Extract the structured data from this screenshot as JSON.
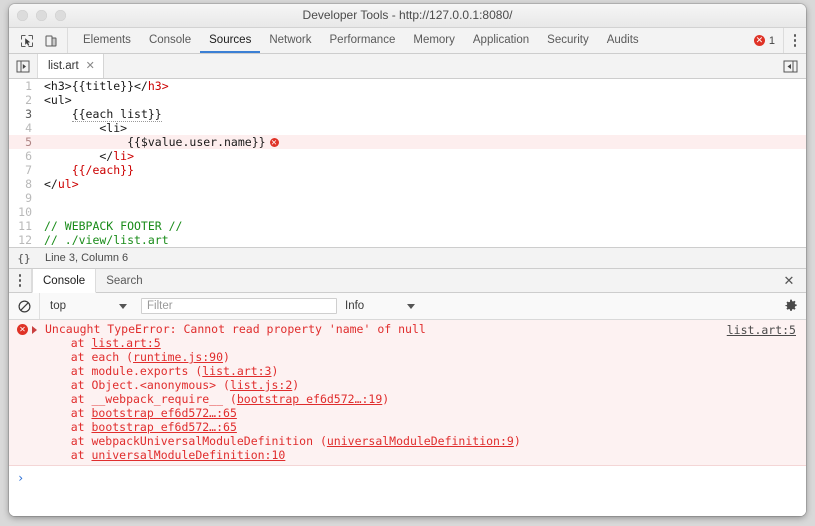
{
  "window": {
    "title": "Developer Tools - http://127.0.0.1:8080/",
    "traffic_lights": [
      "close",
      "minimize",
      "maximize"
    ]
  },
  "toolbar": {
    "inspect_icon": "inspect-element-icon",
    "device_icon": "device-toolbar-icon",
    "panels": [
      {
        "label": "Elements",
        "active": false
      },
      {
        "label": "Console",
        "active": false
      },
      {
        "label": "Sources",
        "active": true
      },
      {
        "label": "Network",
        "active": false
      },
      {
        "label": "Performance",
        "active": false
      },
      {
        "label": "Memory",
        "active": false
      },
      {
        "label": "Application",
        "active": false
      },
      {
        "label": "Security",
        "active": false
      },
      {
        "label": "Audits",
        "active": false
      }
    ],
    "error_count": "1",
    "error_dot_glyph": "✕",
    "accent_color": "#3b7fd4",
    "error_color": "#df3226",
    "menu_icon": "more-vertical-icon"
  },
  "sources": {
    "navigator_toggle_icon": "show-navigator-icon",
    "file_tab": {
      "label": "list.art",
      "close_glyph": "✕"
    },
    "collapse_icon": "collapse-sidebar-icon",
    "code_lines": [
      {
        "num": "1",
        "tokens": [
          {
            "t": "<h3>{{title}}</",
            "c": "tk-tag"
          },
          {
            "t": "h3>",
            "c": "tk-close"
          }
        ]
      },
      {
        "num": "2",
        "tokens": [
          {
            "t": "<ul>",
            "c": "tk-tag"
          }
        ]
      },
      {
        "num": "3",
        "tokens": [
          {
            "t": "    ",
            "c": "tk-plain"
          },
          {
            "t": "{{each list}}",
            "c": "tk-plain squiggle"
          }
        ]
      },
      {
        "num": "4",
        "tokens": [
          {
            "t": "        <li>",
            "c": "tk-tag"
          }
        ]
      },
      {
        "num": "5",
        "highlight": true,
        "error_marker": true,
        "tokens": [
          {
            "t": "            {{$value.user.name}}",
            "c": "tk-plain"
          }
        ]
      },
      {
        "num": "6",
        "tokens": [
          {
            "t": "        </",
            "c": "tk-tag"
          },
          {
            "t": "li>",
            "c": "tk-close"
          }
        ]
      },
      {
        "num": "7",
        "tokens": [
          {
            "t": "    ",
            "c": "tk-plain"
          },
          {
            "t": "{{/each}}",
            "c": "tk-close"
          }
        ]
      },
      {
        "num": "8",
        "tokens": [
          {
            "t": "</",
            "c": "tk-tag"
          },
          {
            "t": "ul>",
            "c": "tk-close"
          }
        ]
      },
      {
        "num": "9",
        "tokens": []
      },
      {
        "num": "10",
        "tokens": []
      },
      {
        "num": "11",
        "tokens": [
          {
            "t": "// WEBPACK FOOTER //",
            "c": "tk-cmt"
          }
        ]
      },
      {
        "num": "12",
        "tokens": [
          {
            "t": "// ./view/list.art",
            "c": "tk-cmt"
          }
        ]
      }
    ],
    "status": {
      "format_icon": "{}",
      "cursor_position": "Line 3, Column 6"
    }
  },
  "drawer": {
    "menu_icon": "more-vertical-icon",
    "tabs": [
      {
        "label": "Console",
        "active": true
      },
      {
        "label": "Search",
        "active": false
      }
    ],
    "close_glyph": "✕",
    "console_toolbar": {
      "clear_icon": "clear-console-icon",
      "context": "top",
      "filter_placeholder": "Filter",
      "filter_value": "",
      "level": "Info",
      "settings_icon": "gear-icon"
    },
    "console_error": {
      "icon": "error-icon",
      "expand_icon": "disclosure-triangle-icon",
      "message": "Uncaught TypeError: Cannot read property 'name' of null",
      "source_link": "list.art:5",
      "stack": [
        {
          "prefix": "    at ",
          "link": "list.art:5",
          "suffix": ""
        },
        {
          "prefix": "    at each (",
          "link": "runtime.js:90",
          "suffix": ")"
        },
        {
          "prefix": "    at module.exports (",
          "link": "list.art:3",
          "suffix": ")"
        },
        {
          "prefix": "    at Object.<anonymous> (",
          "link": "list.js:2",
          "suffix": ")"
        },
        {
          "prefix": "    at __webpack_require__ (",
          "link": "bootstrap ef6d572…:19",
          "suffix": ")"
        },
        {
          "prefix": "    at ",
          "link": "bootstrap ef6d572…:65",
          "suffix": ""
        },
        {
          "prefix": "    at ",
          "link": "bootstrap ef6d572…:65",
          "suffix": ""
        },
        {
          "prefix": "    at webpackUniversalModuleDefinition (",
          "link": "universalModuleDefinition:9",
          "suffix": ")"
        },
        {
          "prefix": "    at ",
          "link": "universalModuleDefinition:10",
          "suffix": ""
        }
      ]
    },
    "prompt_glyph": "›"
  }
}
